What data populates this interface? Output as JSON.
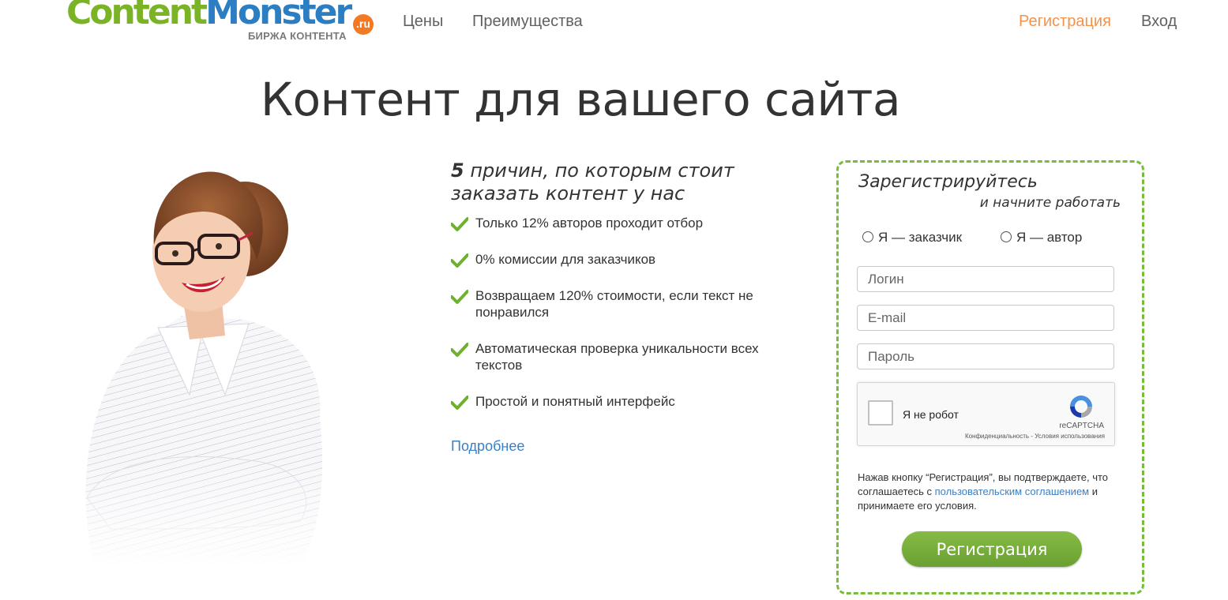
{
  "header": {
    "logo": {
      "part1": "Content",
      "part2": "Monster",
      "badge": ".ru",
      "tagline": "БИРЖА КОНТЕНТА"
    },
    "nav": {
      "prices": "Цены",
      "benefits": "Преимущества",
      "register": "Регистрация",
      "login": "Вход"
    }
  },
  "hero": {
    "title": "Контент для вашего сайта"
  },
  "reasons": {
    "number": "5",
    "title_rest": " причин, по которым стоит заказать контент у нас",
    "items": [
      "Только 12% авторов проходит отбор",
      "0% комиссии для заказчиков",
      "Возвращаем 120% стоимости, если текст не понравился",
      "Автоматическая проверка уникальности всех текстов",
      "Простой и понятный интерфейс"
    ],
    "more_link": "Подробнее"
  },
  "registration": {
    "title_line1": "Зарегистрируйтесь",
    "title_line2": "и начните работать",
    "radio_customer": "Я — заказчик",
    "radio_author": "Я — автор",
    "login_placeholder": "Логин",
    "email_placeholder": "E-mail",
    "password_placeholder": "Пароль",
    "captcha": {
      "label": "Я не робот",
      "brand": "reCAPTCHA",
      "privacy": "Конфиденциальность",
      "separator": " - ",
      "terms": "Условия использования"
    },
    "terms_text_before": "Нажав кнопку “Регистрация”, вы подтверждаете, что соглашаетесь с ",
    "terms_link": "пользовательским соглашением",
    "terms_text_after": " и принимаете его условия.",
    "button": "Регистрация"
  },
  "colors": {
    "brand_green": "#7ab325",
    "brand_blue": "#2b7ec2",
    "accent_orange": "#f6914a",
    "link_blue": "#3b7fc4",
    "dashed_border": "#79bb3b"
  }
}
